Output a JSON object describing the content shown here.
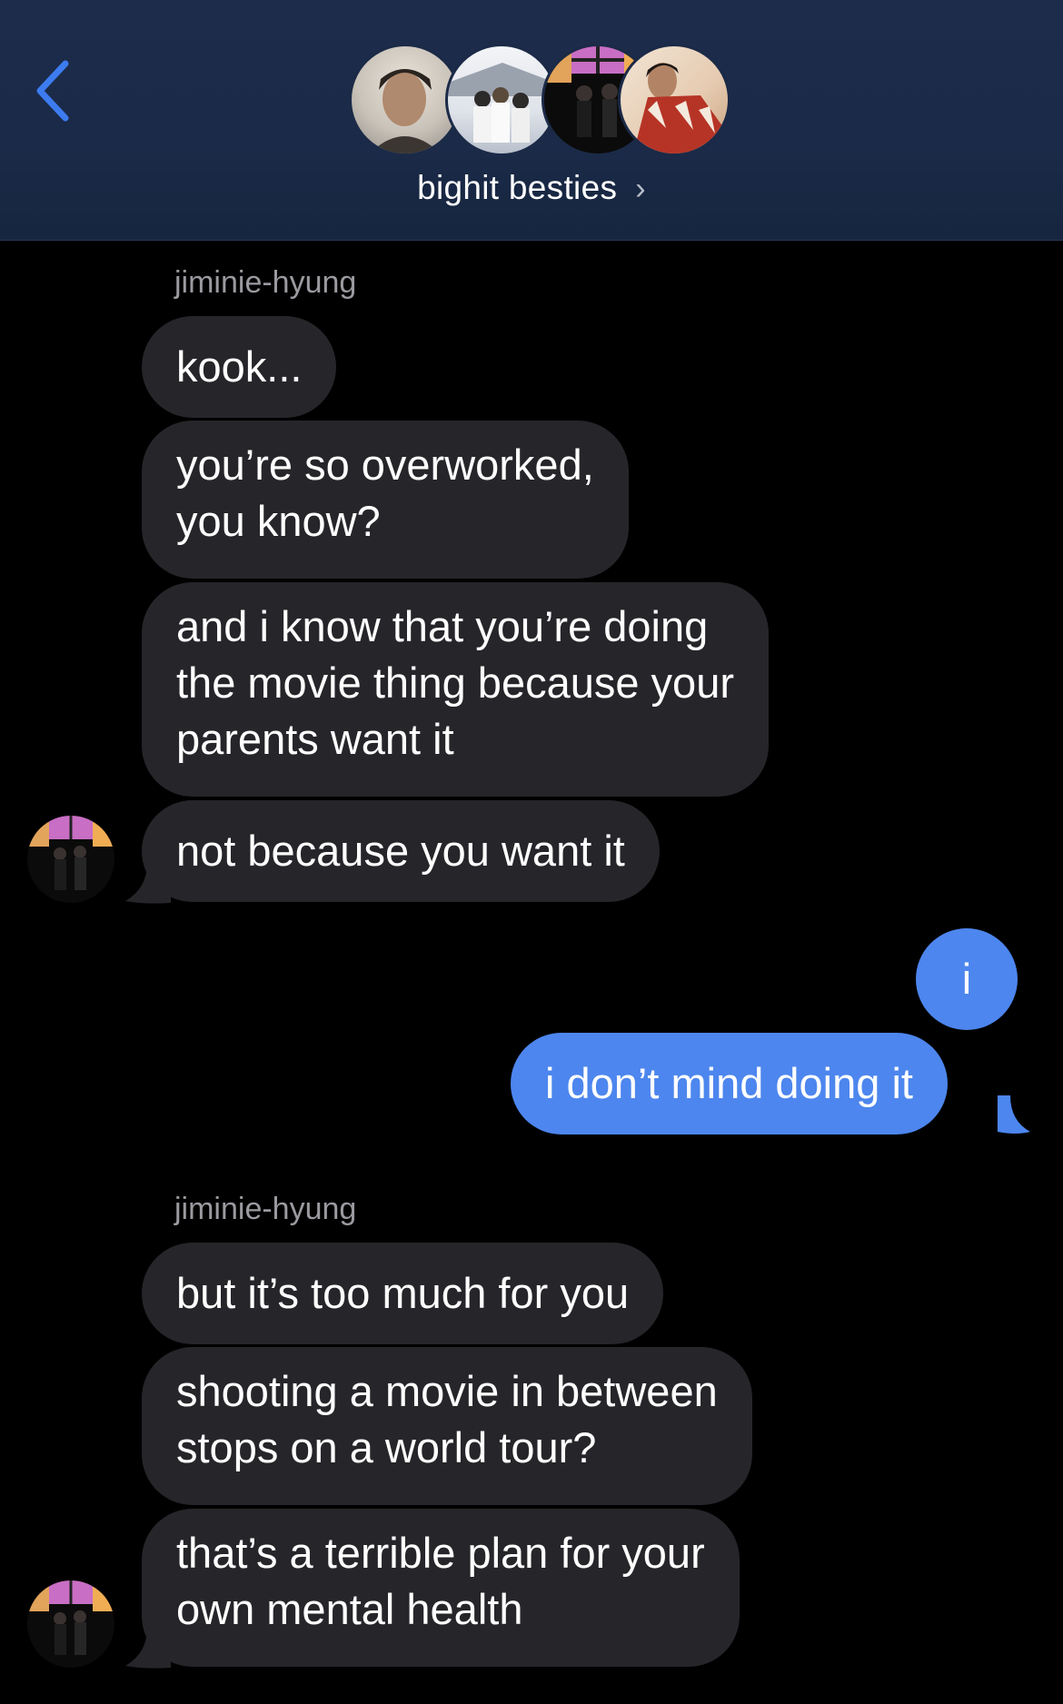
{
  "header": {
    "group_name": "bighit besties",
    "chevron": "›",
    "back_icon": "chevron-left-icon",
    "accent_color": "#3d7cf0"
  },
  "messages": [
    {
      "sender": "jiminie-hyung"
    },
    {
      "text_1": "kook..."
    },
    {
      "text_2a": "you’re so overworked,",
      "text_2b": "you know?"
    },
    {
      "text_3a": "and i know that you’re doing",
      "text_3b": "the movie thing because your",
      "text_3c": "parents want it"
    },
    {
      "text_4": "not because you want it"
    },
    {
      "text_5": "i"
    },
    {
      "text_6": "i don’t mind doing it"
    },
    {
      "sender_2": "jiminie-hyung"
    },
    {
      "text_7": "but it’s too much for you"
    },
    {
      "text_8a": "shooting a movie in between",
      "text_8b": "stops on a world tour?"
    },
    {
      "text_9a": "that’s a terrible plan for your",
      "text_9b": "own mental health"
    }
  ],
  "colors": {
    "incoming_bubble": "#26262a",
    "outgoing_bubble": "#4d86ee",
    "background": "#000000"
  }
}
